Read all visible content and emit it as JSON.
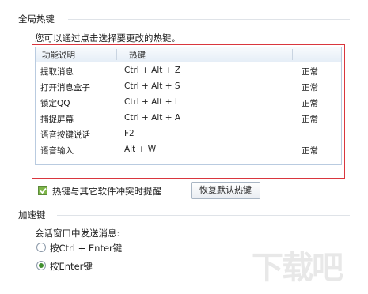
{
  "global_hotkeys": {
    "section_title": "全局热键",
    "description": "您可以通过点击选择要更改的热键。",
    "table": {
      "columns": [
        "功能说明",
        "热键",
        ""
      ],
      "rows": [
        {
          "function": "提取消息",
          "hotkey": "Ctrl + Alt + Z",
          "status": "正常"
        },
        {
          "function": "打开消息盒子",
          "hotkey": "Ctrl + Alt + S",
          "status": "正常"
        },
        {
          "function": "锁定QQ",
          "hotkey": "Ctrl + Alt + L",
          "status": "正常"
        },
        {
          "function": "捕捉屏幕",
          "hotkey": "Ctrl + Alt + A",
          "status": "正常"
        },
        {
          "function": "语音按键说话",
          "hotkey": "F2",
          "status": ""
        },
        {
          "function": "语音输入",
          "hotkey": "Alt + W",
          "status": "正常"
        }
      ]
    },
    "conflict_checkbox": {
      "label": "热键与其它软件冲突时提醒",
      "checked": true
    },
    "restore_button": "恢复默认热键"
  },
  "accelerator": {
    "section_title": "加速键",
    "description": "会话窗口中发送消息:",
    "options": [
      {
        "label": "按Ctrl + Enter键",
        "selected": false
      },
      {
        "label": "按Enter键",
        "selected": true
      }
    ]
  },
  "watermark": "下载吧",
  "colors": {
    "highlight_border": "#d9363e",
    "check_green": "#7db548",
    "radio_green": "#3f8f2f"
  }
}
